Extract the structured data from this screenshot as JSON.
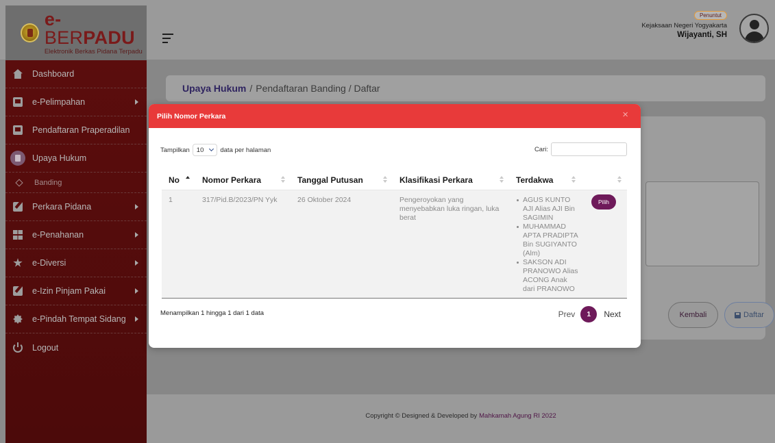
{
  "brand": {
    "title_e": "e-",
    "title_ber": "BER",
    "title_padu": "PADU",
    "subtitle": "Elektronik Berkas Pidana Terpadu"
  },
  "user": {
    "role": "Penuntut",
    "org": "Kejaksaan Negeri Yogyakarta",
    "name": "Wijayanti, SH"
  },
  "sidebar": {
    "items": [
      {
        "label": "Dashboard",
        "icon": "house-icon"
      },
      {
        "label": "e-Pelimpahan",
        "icon": "document-icon"
      },
      {
        "label": "Pendaftaran Praperadilan",
        "icon": "document-icon"
      },
      {
        "label": "Upaya Hukum",
        "icon": "document-icon"
      },
      {
        "label": "Banding",
        "icon": "diamond-icon"
      },
      {
        "label": "Perkara Pidana",
        "icon": "edit-icon"
      },
      {
        "label": "e-Penahanan",
        "icon": "grid-icon"
      },
      {
        "label": "e-Diversi",
        "icon": "star-icon"
      },
      {
        "label": "e-Izin Pinjam Pakai",
        "icon": "edit-icon"
      },
      {
        "label": "e-Pindah Tempat Sidang",
        "icon": "gear-icon"
      },
      {
        "label": "Logout",
        "icon": "power-icon"
      }
    ]
  },
  "breadcrumb": {
    "root": "Upaya Hukum",
    "separator": "/",
    "rest": "Pendaftaran Banding / Daftar"
  },
  "form_buttons": {
    "back_label": "Kembali",
    "submit_label": "Daftar"
  },
  "footer": {
    "text": "Copyright © Designed & Developed by",
    "link": "Mahkamah Agung RI 2022"
  },
  "modal": {
    "title": "Pilih Nomor Perkara",
    "close": "×",
    "length_prefix": "Tampilkan",
    "length_value": "10",
    "length_suffix": "data per halaman",
    "search_label": "Cari:",
    "search_value": "",
    "columns": [
      "No",
      "Nomor Perkara",
      "Tanggal Putusan",
      "Klasifikasi Perkara",
      "Terdakwa",
      ""
    ],
    "rows": [
      {
        "no": "1",
        "nomor_perkara": "317/Pid.B/2023/PN Yyk",
        "tanggal_putusan": "26 Oktober 2024",
        "klasifikasi": "Pengeroyokan yang menyebabkan luka ringan, luka berat",
        "terdakwa": [
          "AGUS KUNTO AJI Alias AJI Bin SAGIMIN",
          "MUHAMMAD APTA PRADIPTA Bin SUGIYANTO (Alm)",
          "SAKSON ADI PRANOWO Alias ACONG Anak dari PRANOWO"
        ],
        "action": "Pilih"
      }
    ],
    "info": "Menampilkan 1 hingga 1 dari 1 data",
    "pager": {
      "prev": "Prev",
      "current": "1",
      "next": "Next"
    }
  }
}
